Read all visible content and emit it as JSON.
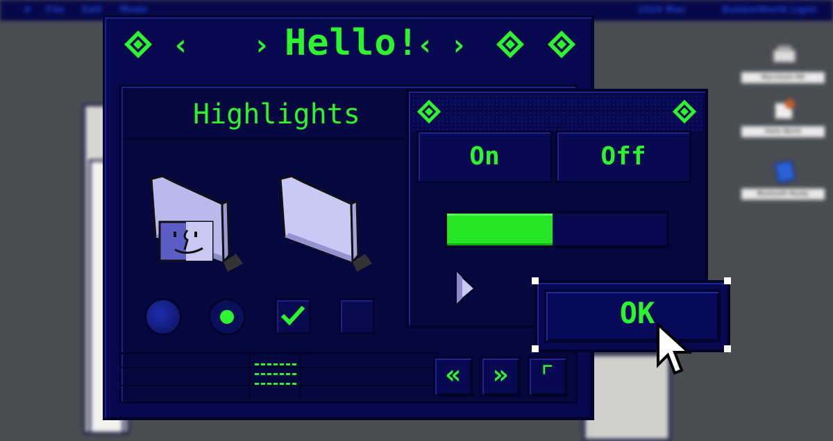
{
  "menubar": {
    "items": [
      "File",
      "Edit",
      "Mode"
    ],
    "right_items": [
      "1024 Mac",
      "BubbleWorld Light"
    ]
  },
  "desktop_icons": [
    "Macintosh HD",
    "Hello World",
    "Bluetooth Ready"
  ],
  "main_window": {
    "title": "Hello!",
    "tab_label": "Highlights",
    "left_controls": [
      "diamond-icon",
      "chevron-left-icon",
      "chevron-right-icon"
    ],
    "right_controls": [
      "chevron-left-icon",
      "chevron-right-icon",
      "diamond-icon",
      "diamond-icon"
    ],
    "radios": [
      {
        "state": "unselected"
      },
      {
        "state": "selected"
      }
    ],
    "checkboxes": [
      {
        "checked": true
      },
      {
        "checked": false
      }
    ],
    "nav": {
      "back_glyph": "«",
      "forward_glyph": "»",
      "expand_glyph": "⌜"
    }
  },
  "toggle_window": {
    "on_label": "On",
    "off_label": "Off",
    "progress_fraction": 0.48
  },
  "ok_button": {
    "label": "OK"
  },
  "colors": {
    "accent": "#2df52d",
    "panel": "#06094f",
    "border": "#01032a",
    "folder": "#c9c9f5"
  }
}
